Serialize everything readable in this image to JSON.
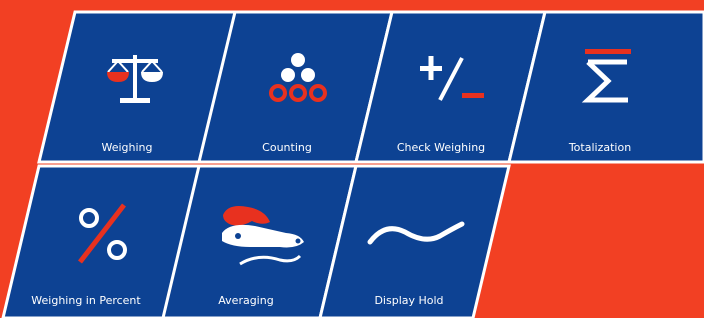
{
  "colors": {
    "background": "#f24023",
    "tile": "#0d4293",
    "tile_border": "#ffffff",
    "accent": "#e8311f",
    "icon_white": "#ffffff"
  },
  "modes": [
    {
      "label": "Weighing",
      "icon": "balance-scale-icon"
    },
    {
      "label": "Counting",
      "icon": "counting-dots-icon"
    },
    {
      "label": "Check Weighing",
      "icon": "plus-minus-icon"
    },
    {
      "label": "Totalization",
      "icon": "sigma-icon"
    },
    {
      "label": "Weighing in Percent",
      "icon": "percent-icon"
    },
    {
      "label": "Averaging",
      "icon": "moving-animal-icon"
    },
    {
      "label": "Display Hold",
      "icon": "tilde-wave-icon"
    }
  ]
}
